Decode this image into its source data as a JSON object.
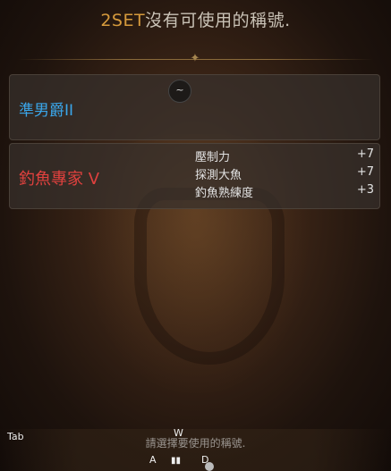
{
  "header": {
    "title_accent": "2SET",
    "title_rest": "沒有可使用的稱號."
  },
  "titles": [
    {
      "name": "準男爵II",
      "color": "#3aa6ea",
      "hotkey": "~"
    },
    {
      "name": "釣魚專家 V",
      "color": "#e0413e",
      "stats": [
        {
          "label": "壓制力",
          "value": "+7"
        },
        {
          "label": "探測大魚",
          "value": "+7"
        },
        {
          "label": "釣魚熟練度",
          "value": "+3"
        }
      ]
    }
  ],
  "footer": {
    "tab_label": "Tab",
    "hint": "請選擇要使用的稱號.",
    "keys": {
      "up": "W",
      "left": "A",
      "right": "D"
    }
  }
}
